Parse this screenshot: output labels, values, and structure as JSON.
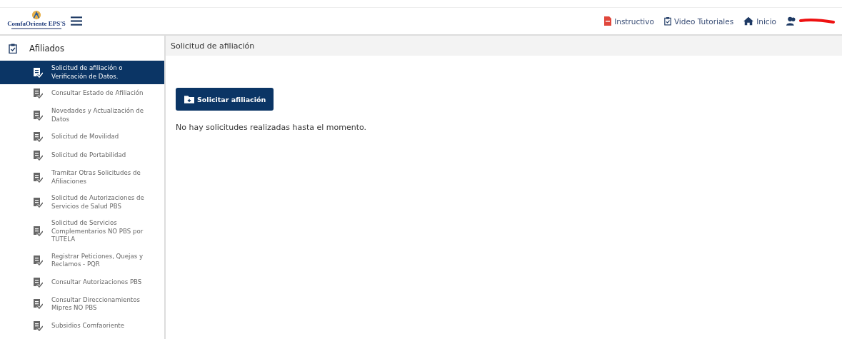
{
  "header": {
    "logo": "ComfaOriente EPS'S",
    "links": [
      {
        "label": "Instructivo",
        "kind": "pdf"
      },
      {
        "label": "Video Tutoriales",
        "kind": "clipboard"
      },
      {
        "label": "Inicio",
        "kind": "home"
      }
    ]
  },
  "sidebar": {
    "section": "Afiliados",
    "items": [
      {
        "label": "Solicitud de afiliación o Verificación de Datos.",
        "selected": true
      },
      {
        "label": "Consultar Estado de Afiliación",
        "selected": false
      },
      {
        "label": "Novedades y Actualización de Datos",
        "selected": false
      },
      {
        "label": "Solicitud de Movilidad",
        "selected": false
      },
      {
        "label": "Solicitud de Portabilidad",
        "selected": false
      },
      {
        "label": "Tramitar Otras Solicitudes de Afiliaciones",
        "selected": false
      },
      {
        "label": "Solicitud de Autorizaciones de Servicios de Salud PBS",
        "selected": false
      },
      {
        "label": "Solicitud de Servicios Complementarios NO PBS por TUTELA",
        "selected": false
      },
      {
        "label": "Registrar Peticiones, Quejas y Reclamos - PQR",
        "selected": false
      },
      {
        "label": "Consultar Autorizaciones PBS",
        "selected": false
      },
      {
        "label": "Consultar Direccionamientos Mipres NO PBS",
        "selected": false
      },
      {
        "label": "Subsidios Comfaoriente",
        "selected": false
      }
    ]
  },
  "main": {
    "title": "Solicitud de afiliación",
    "button": "Solicitar afiliación",
    "message": "No hay solicitudes realizadas hasta el momento."
  }
}
